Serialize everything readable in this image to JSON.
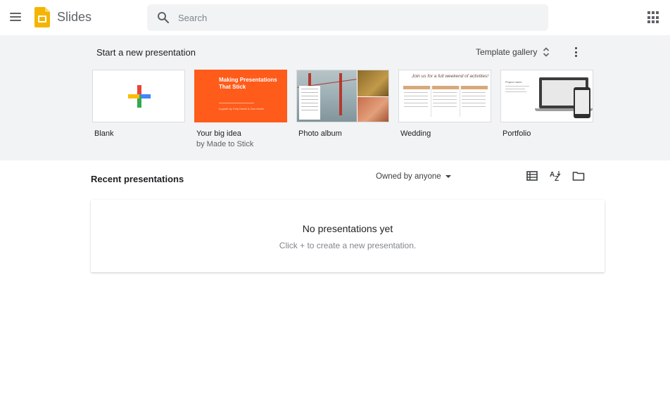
{
  "header": {
    "app_title": "Slides",
    "search": {
      "placeholder": "Search",
      "value": ""
    },
    "icons": {
      "menu": "hamburger-menu-icon",
      "logo": "slides-logo-icon",
      "search": "search-icon",
      "apps": "apps-grid-icon"
    }
  },
  "templates_section": {
    "title": "Start a new presentation",
    "gallery_label": "Template gallery",
    "templates": [
      {
        "name": "Blank",
        "subtitle": ""
      },
      {
        "name": "Your big idea",
        "subtitle": "by Made to Stick",
        "thumb_title": "Making Presentations That Stick",
        "thumb_sub": "A guide by Chip Heath & Dan Heath"
      },
      {
        "name": "Photo album",
        "subtitle": ""
      },
      {
        "name": "Wedding",
        "subtitle": "",
        "thumb_title": "Join us for a full weekend of activities!"
      },
      {
        "name": "Portfolio",
        "subtitle": "",
        "thumb_title": "Project name"
      }
    ]
  },
  "recent": {
    "title": "Recent presentations",
    "owner_filter": "Owned by anyone",
    "empty_title": "No presentations yet",
    "empty_subtitle": "Click + to create a new presentation."
  },
  "colors": {
    "accent_yellow": "#f4b400",
    "orange_template": "#ff5b1a",
    "section_bg": "#f1f3f4"
  }
}
